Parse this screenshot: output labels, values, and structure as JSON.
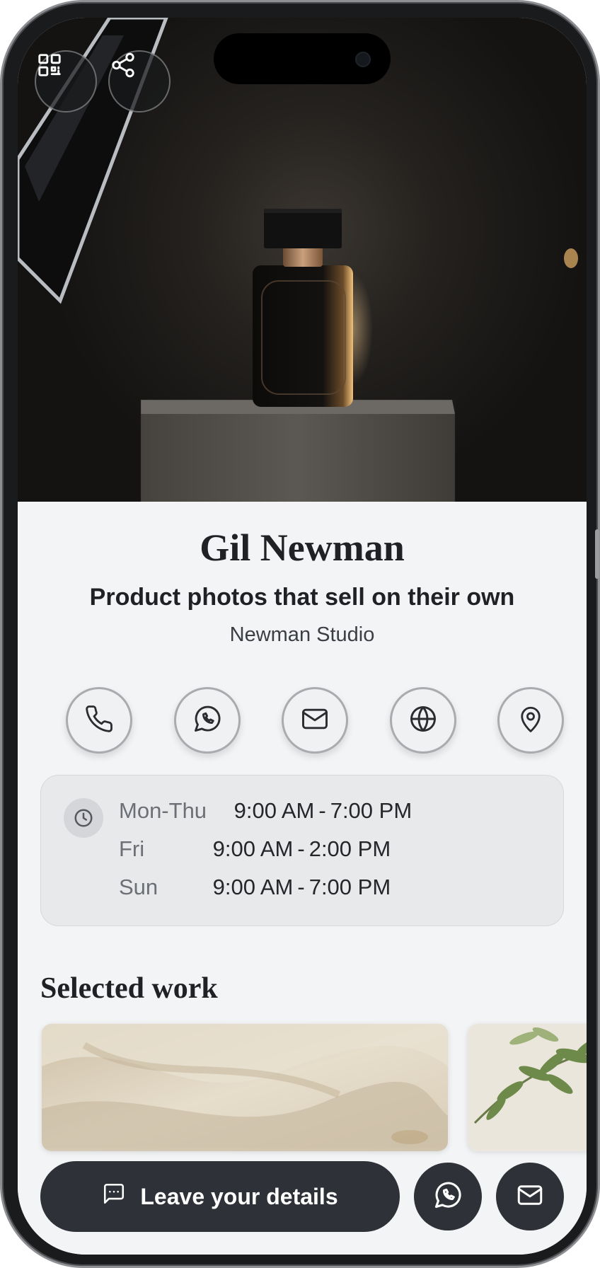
{
  "profile": {
    "name": "Gil Newman",
    "tagline": "Product photos that sell on their own",
    "company": "Newman Studio"
  },
  "hero": {
    "image": "perfume-bottle-on-stone-pedestal-photo"
  },
  "header_buttons": [
    {
      "icon": "qr-code-icon"
    },
    {
      "icon": "share-icon"
    }
  ],
  "contact_actions": [
    {
      "icon": "phone-icon"
    },
    {
      "icon": "whatsapp-icon"
    },
    {
      "icon": "email-icon"
    },
    {
      "icon": "globe-icon"
    },
    {
      "icon": "location-pin-icon"
    }
  ],
  "hours": {
    "icon": "clock-icon",
    "rows": [
      {
        "days": "Mon-Thu",
        "open": "9:00 AM",
        "separator": "-",
        "close": "7:00 PM"
      },
      {
        "days": "Fri",
        "open": "9:00 AM",
        "separator": "-",
        "close": "2:00 PM"
      },
      {
        "days": "Sun",
        "open": "9:00 AM",
        "separator": "-",
        "close": "7:00 PM"
      }
    ]
  },
  "gallery": {
    "title": "Selected work",
    "items": [
      {
        "image": "cream-fabric-photo"
      },
      {
        "image": "olive-branch-photo"
      }
    ]
  },
  "bottom_bar": {
    "cta_label": "Leave your details",
    "cta_icon": "message-square-icon",
    "actions": [
      {
        "icon": "whatsapp-icon"
      },
      {
        "icon": "email-icon"
      }
    ]
  },
  "colors": {
    "dark_button": "#2e3137",
    "page_background": "#f3f4f6",
    "text_primary": "#1f2125"
  }
}
